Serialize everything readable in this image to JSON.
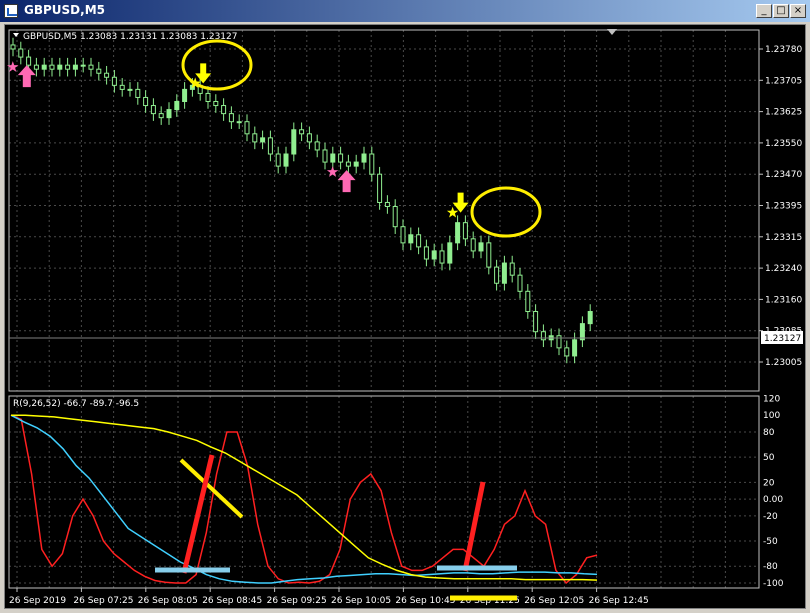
{
  "window": {
    "title": "GBPUSD,M5",
    "minimize_label": "_",
    "maximize_label": "□",
    "close_label": "×"
  },
  "main_chart": {
    "header": "GBPUSD,M5  1.23083 1.23131 1.23083 1.23127",
    "current_price": "1.23127",
    "price_ticks": [
      "1.23780",
      "1.23705",
      "1.23625",
      "1.23550",
      "1.23470",
      "1.23395",
      "1.23315",
      "1.23240",
      "1.23160",
      "1.23085",
      "1.23005"
    ]
  },
  "indicator": {
    "header": "R(9,26,52) -66.7 -89.7 -96.5",
    "ticks": [
      "120",
      "100",
      "80",
      "50",
      "20",
      "0.00",
      "-20",
      "-50",
      "-80",
      "-100"
    ]
  },
  "time_axis": [
    "26 Sep 2019",
    "26 Sep 07:25",
    "26 Sep 08:05",
    "26 Sep 08:45",
    "26 Sep 09:25",
    "26 Sep 10:05",
    "26 Sep 10:45",
    "26 Sep 11:25",
    "26 Sep 12:05",
    "26 Sep 12:45"
  ],
  "colors": {
    "background": "#000000",
    "grid": "#4a4a4a",
    "candles": "#90ee90",
    "fast_line": "#ff2020",
    "medium_line": "#40d0ff",
    "slow_line": "#ffff00",
    "buy_arrow": "#ff69b4",
    "sell_arrow": "#ffff00"
  },
  "chart_data": {
    "type": "candlestick",
    "symbol": "GBPUSD",
    "timeframe": "M5",
    "ohlc_last": {
      "open": 1.23083,
      "high": 1.23131,
      "low": 1.23083,
      "close": 1.23127
    },
    "ylim": [
      1.23005,
      1.2378
    ],
    "closes": [
      1.2378,
      1.2376,
      1.2374,
      1.2373,
      1.2374,
      1.2373,
      1.2374,
      1.2373,
      1.2374,
      1.2374,
      1.2373,
      1.2372,
      1.2371,
      1.2369,
      1.2368,
      1.2368,
      1.2366,
      1.2364,
      1.2362,
      1.2361,
      1.2363,
      1.2365,
      1.2368,
      1.2369,
      1.2367,
      1.2365,
      1.2364,
      1.2362,
      1.236,
      1.236,
      1.2357,
      1.2355,
      1.2356,
      1.2352,
      1.2349,
      1.2352,
      1.2358,
      1.2357,
      1.2355,
      1.2353,
      1.235,
      1.2352,
      1.235,
      1.2349,
      1.235,
      1.2352,
      1.2347,
      1.234,
      1.2339,
      1.2334,
      1.233,
      1.2332,
      1.2329,
      1.2326,
      1.2328,
      1.2325,
      1.233,
      1.2335,
      1.2331,
      1.2328,
      1.233,
      1.2324,
      1.232,
      1.2325,
      1.2322,
      1.2318,
      1.2313,
      1.2308,
      1.2306,
      1.2307,
      1.2304,
      1.2302,
      1.2306,
      1.231,
      1.2313
    ],
    "buy_signals": [
      1,
      42
    ],
    "sell_signals": [
      24,
      57
    ],
    "indicator": {
      "name": "R(9,26,52)",
      "last_values": [
        -66.7,
        -89.7,
        -96.5
      ],
      "ylim": [
        -100,
        120
      ],
      "series": [
        {
          "values": [
            100,
            95,
            30,
            -60,
            -80,
            -65,
            -20,
            0,
            -20,
            -50,
            -65,
            -75,
            -85,
            -92,
            -97,
            -99,
            -100,
            -100,
            -90,
            -40,
            30,
            80,
            80,
            40,
            -30,
            -80,
            -95,
            -100,
            -99,
            -100,
            -98,
            -90,
            -60,
            0,
            20,
            30,
            10,
            -40,
            -80,
            -85,
            -85,
            -80,
            -70,
            -60,
            -60,
            -70,
            -80,
            -60,
            -30,
            -20,
            10,
            -20,
            -30,
            -85,
            -100,
            -90,
            -70,
            -66.7
          ]
        },
        {
          "values": [
            100,
            92,
            85,
            75,
            60,
            40,
            25,
            5,
            -15,
            -35,
            -45,
            -55,
            -65,
            -75,
            -82,
            -90,
            -95,
            -98,
            -99,
            -100,
            -100,
            -98,
            -96,
            -95,
            -94,
            -92,
            -91,
            -90,
            -89,
            -89,
            -90,
            -91,
            -90,
            -89,
            -88,
            -88,
            -89,
            -89,
            -88,
            -87,
            -87,
            -87,
            -88,
            -88,
            -89,
            -89.7
          ]
        },
        {
          "values": [
            100,
            100,
            99,
            98,
            96,
            94,
            92,
            90,
            88,
            86,
            84,
            80,
            75,
            70,
            62,
            55,
            45,
            35,
            25,
            15,
            5,
            -10,
            -25,
            -40,
            -55,
            -70,
            -78,
            -85,
            -90,
            -93,
            -94,
            -95,
            -95,
            -95,
            -95,
            -95,
            -96,
            -96,
            -96,
            -96,
            -96,
            -96.5
          ]
        }
      ]
    }
  }
}
